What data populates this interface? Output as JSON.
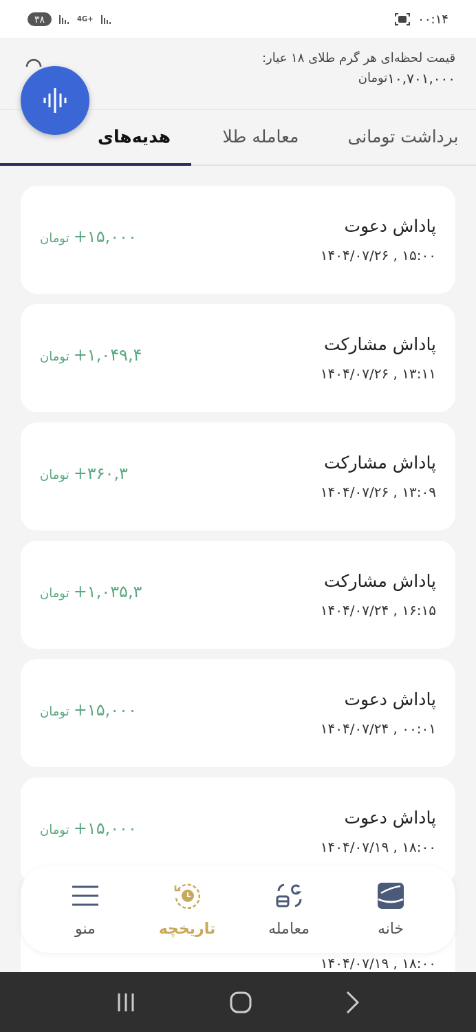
{
  "status_bar": {
    "time": "۰۰:۱۴",
    "battery": "۳۸",
    "network": "4G+"
  },
  "header": {
    "price_label": "قیمت لحظه‌ای هر گرم طلای ۱۸ عیار:",
    "price_value": "۱۰,۷۰۱,۰۰۰",
    "price_unit": "تومان"
  },
  "tabs": [
    {
      "label": "برداشت تومانی",
      "selected": false
    },
    {
      "label": "معامله طلا",
      "selected": false
    },
    {
      "label": "هدیه‌های",
      "selected": true
    }
  ],
  "rewards": [
    {
      "title": "پاداش دعوت",
      "date": "۱۴۰۴/۰۷/۲۶ , ۱۵:۰۰",
      "amount": "+۱۵,۰۰۰",
      "unit": "تومان"
    },
    {
      "title": "پاداش مشارکت",
      "date": "۱۴۰۴/۰۷/۲۶ , ۱۳:۱۱",
      "amount": "+۱,۰۴۹,۴",
      "unit": "تومان"
    },
    {
      "title": "پاداش مشارکت",
      "date": "۱۴۰۴/۰۷/۲۶ , ۱۳:۰۹",
      "amount": "+۳۶۰,۳",
      "unit": "تومان"
    },
    {
      "title": "پاداش مشارکت",
      "date": "۱۴۰۴/۰۷/۲۴ , ۱۶:۱۵",
      "amount": "+۱,۰۳۵,۳",
      "unit": "تومان"
    },
    {
      "title": "پاداش دعوت",
      "date": "۱۴۰۴/۰۷/۲۴ , ۰۰:۰۱",
      "amount": "+۱۵,۰۰۰",
      "unit": "تومان"
    },
    {
      "title": "پاداش دعوت",
      "date": "۱۴۰۴/۰۷/۱۹ , ۱۸:۰۰",
      "amount": "+۱۵,۰۰۰",
      "unit": "تومان"
    },
    {
      "date": "۱۴۰۴/۰۷/۱۹ , ۱۸:۰۰"
    }
  ],
  "bottom_nav": [
    {
      "kind": "home",
      "label": "خانه",
      "selected": false
    },
    {
      "kind": "trade",
      "label": "معامله",
      "selected": false
    },
    {
      "kind": "history",
      "label": "تاریخچه",
      "selected": true
    },
    {
      "kind": "menu",
      "label": "منو",
      "selected": false
    }
  ]
}
